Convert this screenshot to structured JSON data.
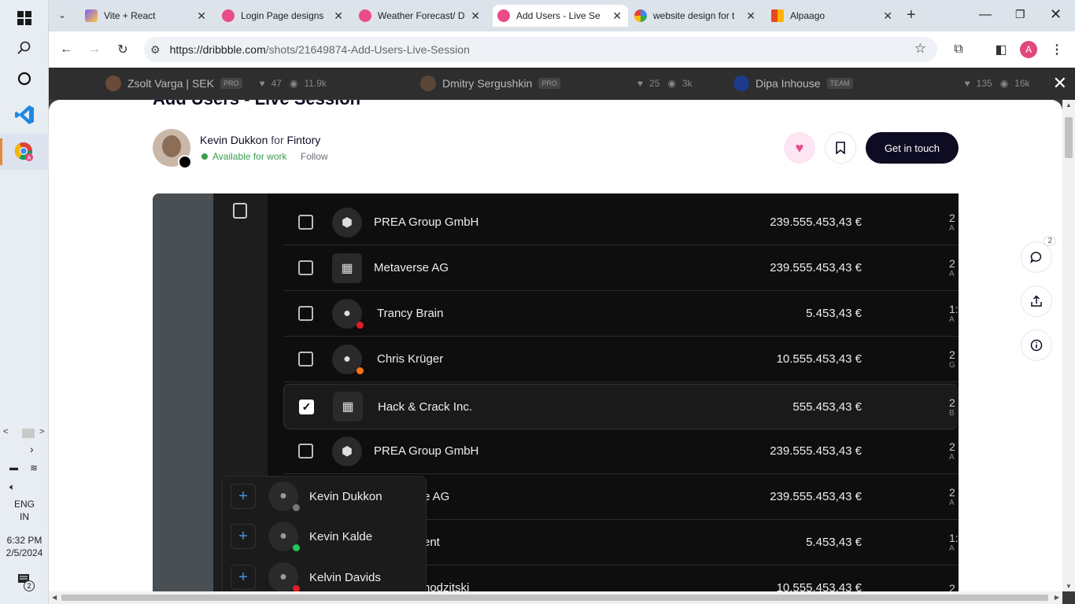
{
  "browser": {
    "tabs": [
      {
        "title": "Vite + React",
        "active": false
      },
      {
        "title": "Login Page designs",
        "active": false
      },
      {
        "title": "Weather Forecast/ D",
        "active": false
      },
      {
        "title": "Add Users - Live Se",
        "active": true
      },
      {
        "title": "website design for t",
        "active": false
      },
      {
        "title": "Alpaago",
        "active": false
      }
    ],
    "url_domain": "https://dribbble.com",
    "url_path": "/shots/21649874-Add-Users-Live-Session",
    "profile_initial": "A"
  },
  "taskbar": {
    "lang1": "ENG",
    "lang2": "IN",
    "time": "6:32 PM",
    "date": "2/5/2024",
    "notif_count": "2"
  },
  "related": [
    {
      "name": "Zsolt Varga | SEK",
      "badge": "PRO",
      "likes": "47",
      "views": "11.9k"
    },
    {
      "name": "Dmitry Sergushkin",
      "badge": "PRO",
      "likes": "25",
      "views": "3k"
    },
    {
      "name": "Dipa Inhouse",
      "badge": "TEAM",
      "likes": "135",
      "views": "16k"
    }
  ],
  "shot": {
    "title": "Add Users - Live Session",
    "author": "Kevin Dukkon",
    "for_word": "for",
    "team": "Fintory",
    "availability": "Available for work",
    "follow": "Follow",
    "cta": "Get in touch"
  },
  "rows": [
    {
      "name": "PREA Group GmbH",
      "amount": "239.555.453,43 €",
      "cut": "2",
      "sub": "A",
      "checked": false
    },
    {
      "name": "Metaverse AG",
      "amount": "239.555.453,43 €",
      "cut": "2",
      "sub": "A",
      "checked": false
    },
    {
      "name": "Trancy Brain",
      "amount": "5.453,43 €",
      "cut": "1:",
      "sub": "A",
      "checked": false
    },
    {
      "name": "Chris Krüger",
      "amount": "10.555.453,43 €",
      "cut": "2",
      "sub": "G",
      "checked": false
    },
    {
      "name": "Hack & Crack Inc.",
      "amount": "555.453,43 €",
      "cut": "2",
      "sub": "B",
      "checked": true
    },
    {
      "name": "PREA Group GmbH",
      "amount": "239.555.453,43 €",
      "cut": "2",
      "sub": "A",
      "checked": false
    },
    {
      "name": "e AG",
      "amount": "239.555.453,43 €",
      "cut": "2",
      "sub": "A",
      "checked": false
    },
    {
      "name": "ent",
      "amount": "5.453,43 €",
      "cut": "1:",
      "sub": "A",
      "checked": false
    },
    {
      "name": "hodzitski",
      "amount": "10.555.453,43 €",
      "cut": "2",
      "sub": "",
      "checked": false
    }
  ],
  "popover": [
    {
      "name": "Kevin Dukkon",
      "status_color": "#777777"
    },
    {
      "name": "Kevin Kalde",
      "status_color": "#22c55e"
    },
    {
      "name": "Kelvin Davids",
      "status_color": "#e11d2b"
    }
  ],
  "comments_count": "2",
  "colors": {
    "accent_pink": "#ea4c89",
    "dark": "#0d0c22",
    "green": "#3a9b4f"
  }
}
